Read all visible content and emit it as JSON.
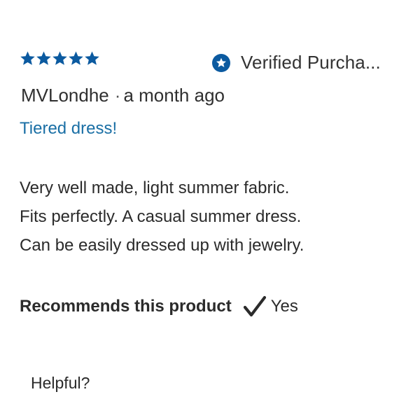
{
  "review": {
    "rating": 5,
    "rating_max": 5,
    "star_color": "#0b5aa0",
    "verified_label": "Verified Purcha...",
    "verified_color": "#0b5aa0",
    "author": "MVLondhe",
    "separator": "·",
    "time_ago": "a month ago",
    "title": "Tiered dress!",
    "title_color": "#1a6fa5",
    "body_lines": [
      "Very well made, light summer fabric.",
      "Fits perfectly. A casual summer dress.",
      "Can be easily dressed up with jewelry."
    ],
    "recommend_label": "Recommends this product",
    "recommend_icon": "checkmark-icon",
    "recommend_value": "Yes",
    "helpful_label": "Helpful?"
  }
}
